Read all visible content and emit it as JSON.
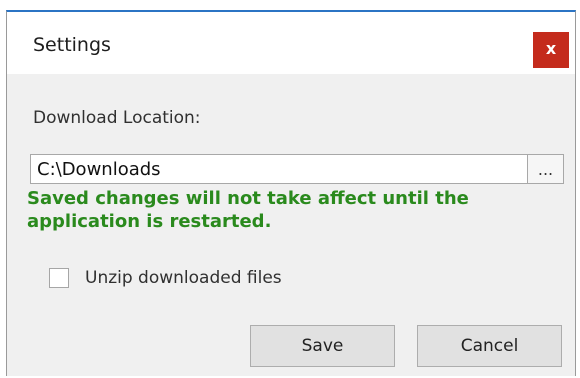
{
  "dialog": {
    "title": "Settings",
    "close_label": "x",
    "accent_color": "#2b74c4",
    "close_color": "#c42b1c"
  },
  "download": {
    "label": "Download Location:",
    "path_value": "C:\\Downloads",
    "browse_label": "..."
  },
  "warning": {
    "text": "Saved changes will not take affect until the application is restarted.",
    "color": "#2a8a1d"
  },
  "options": {
    "unzip_label": "Unzip downloaded files",
    "unzip_checked": false
  },
  "buttons": {
    "save_label": "Save",
    "cancel_label": "Cancel"
  }
}
